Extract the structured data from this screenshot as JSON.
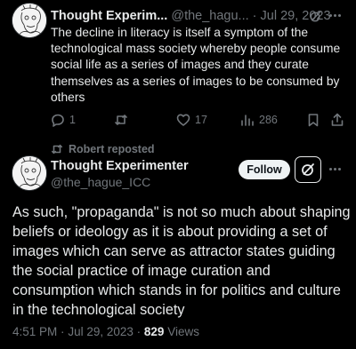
{
  "reply_tweet": {
    "author_name": "Thought Experim...",
    "author_handle": "@the_hagu...",
    "separator": "·",
    "date": "Jul 29, 2023",
    "text": "The decline in literacy is itself a symptom of the technological mass society whereby people consume social life as a series of images and they curate themselves as a series of images to be consumed by others",
    "replies": "1",
    "likes": "17",
    "views": "286",
    "icons": [
      "grok-icon",
      "more-icon",
      "reply-icon",
      "repost-icon",
      "like-icon",
      "views-icon",
      "bookmark-icon",
      "share-icon"
    ]
  },
  "repost_banner": {
    "label": "Robert reposted"
  },
  "main_tweet": {
    "author_name": "Thought Experimenter",
    "author_handle": "@the_hague_ICC",
    "follow_label": "Follow",
    "text": "As such, \"propaganda\" is not so much about shaping beliefs or ideology as it is about providing a set of images which can serve as attractor states guiding the social practice of image curation and consumption which stands in for politics and culture in the technological society",
    "time": "4:51 PM",
    "separator": "·",
    "date": "Jul 29, 2023",
    "separator2": "·",
    "view_count": "829",
    "views_label": "Views"
  },
  "colors": {
    "background": "#000000",
    "text": "#e7e9ea",
    "muted": "#71767b",
    "follow_bg": "#eff3f4"
  }
}
